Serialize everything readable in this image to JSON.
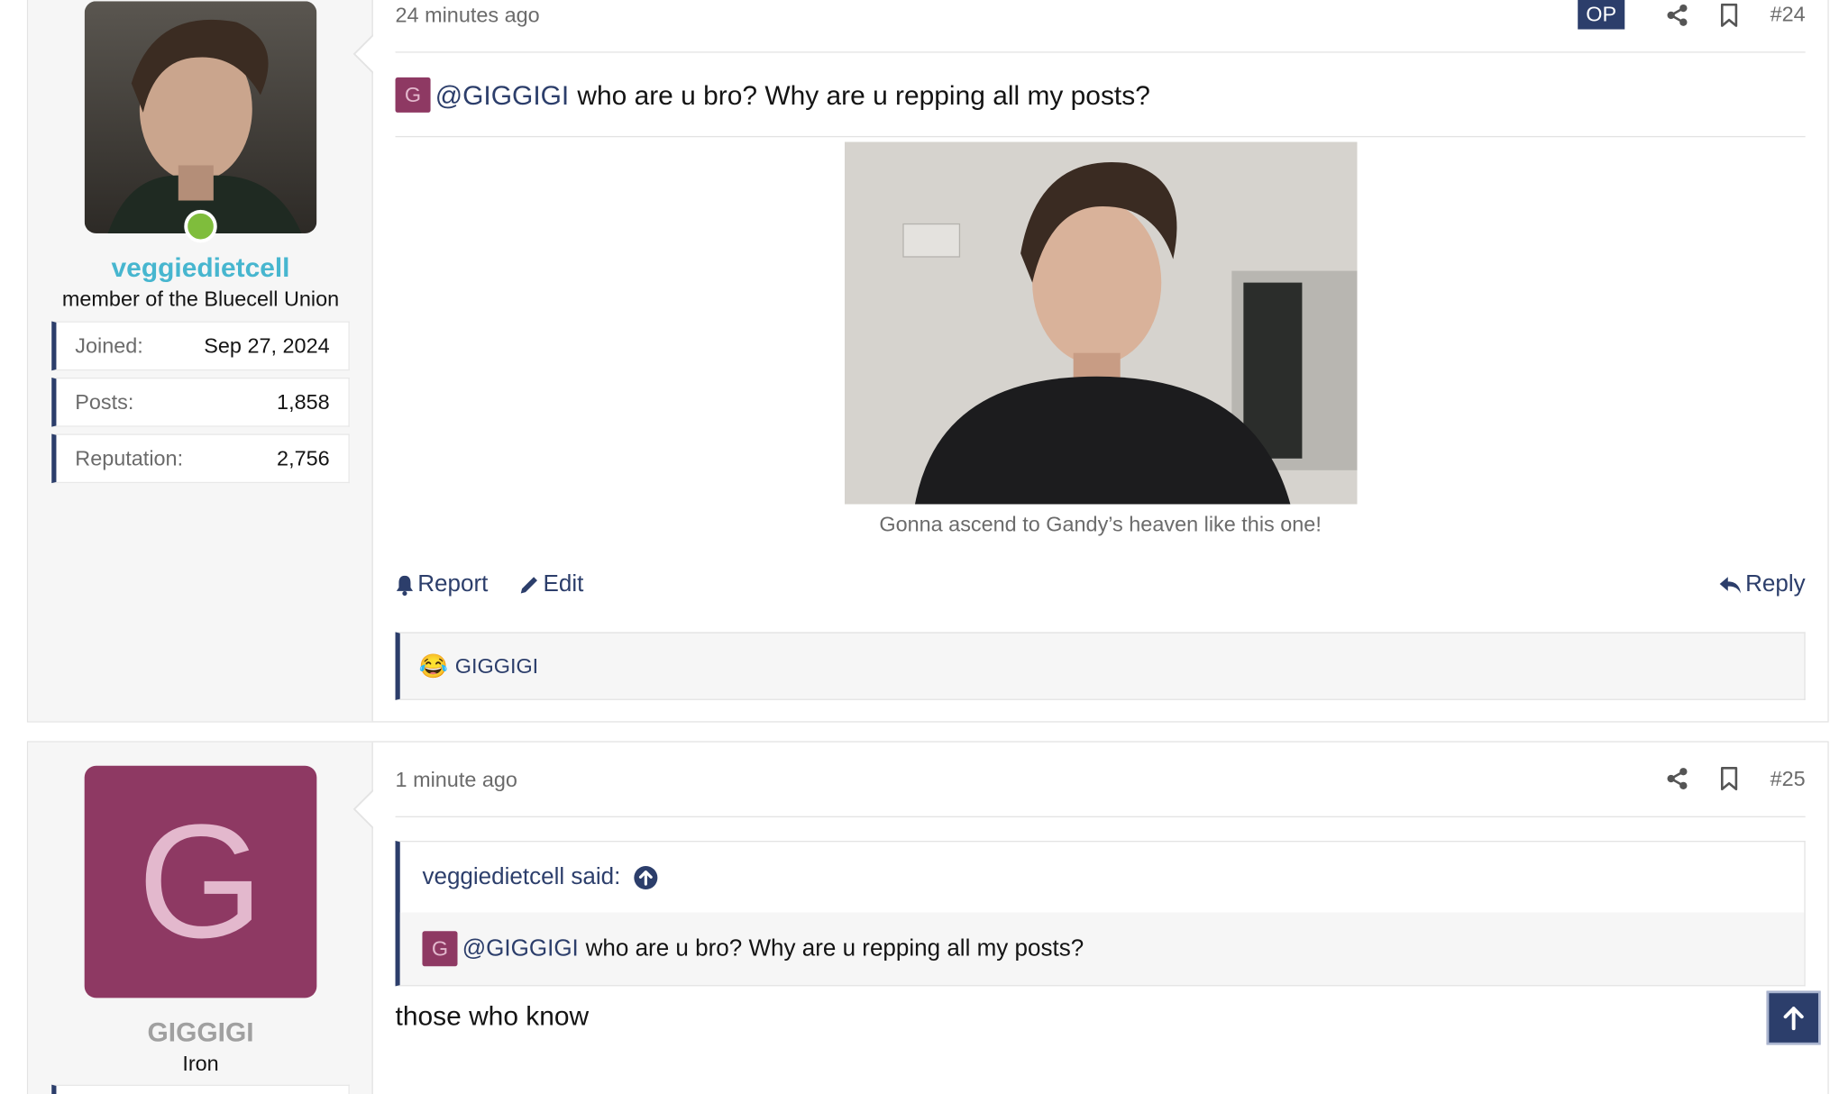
{
  "colors": {
    "accent": "#2c3e6b",
    "username_blue": "#47b6cf",
    "username_gray": "#a0a0a0",
    "avatar_magenta": "#8e3963",
    "online_green": "#7fbd3c"
  },
  "posts": [
    {
      "user": {
        "name": "veggiedietcell",
        "title": "member of the Bluecell Union",
        "online": true,
        "stats": [
          {
            "label": "Joined:",
            "value": "Sep 27, 2024"
          },
          {
            "label": "Posts:",
            "value": "1,858"
          },
          {
            "label": "Reputation:",
            "value": "2,756"
          }
        ]
      },
      "time": "24 minutes ago",
      "op_badge": "OP",
      "number": "#24",
      "mention_initial": "G",
      "mention": "@GIGGIGI",
      "body": "who are u bro? Why are u repping all my posts?",
      "caption": "Gonna ascend to Gandy’s heaven like this one!",
      "actions": {
        "report": "Report",
        "edit": "Edit",
        "reply": "Reply"
      },
      "reaction_emoji": "😂",
      "reaction_user": "GIGGIGI"
    },
    {
      "user": {
        "initial": "G",
        "name": "GIGGIGI",
        "title": "Iron"
      },
      "time": "1 minute ago",
      "number": "#25",
      "quote": {
        "author": "veggiedietcell said:",
        "mention_initial": "G",
        "mention": "@GIGGIGI",
        "text": "who are u bro? Why are u repping all my posts?"
      },
      "body": "those who know"
    }
  ]
}
